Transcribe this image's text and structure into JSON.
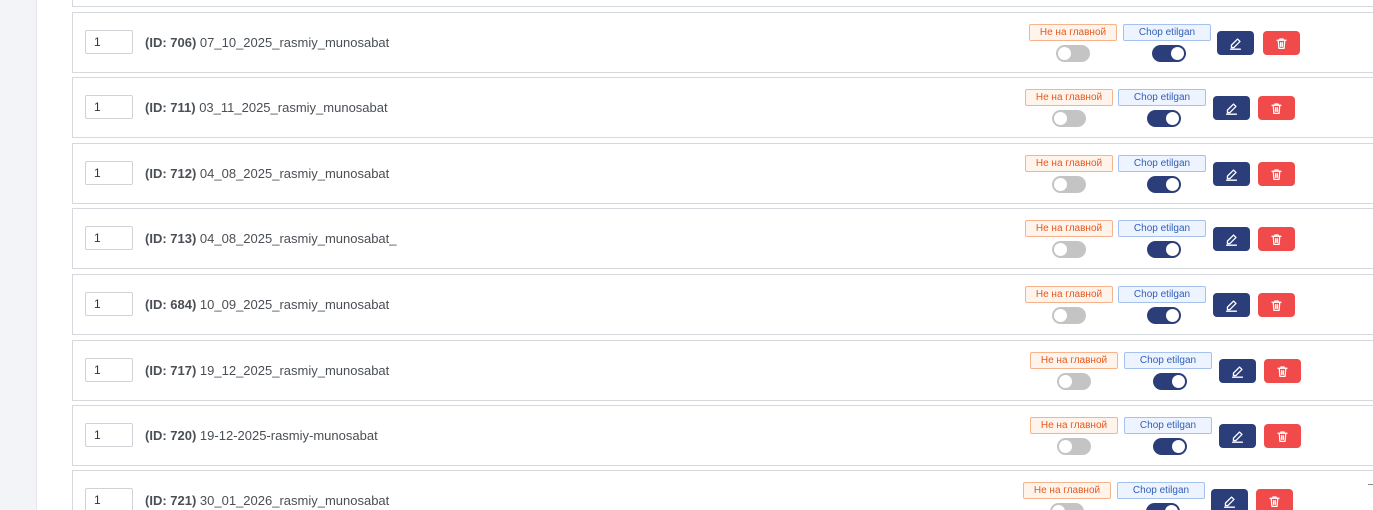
{
  "rows": [
    {
      "order": "1",
      "id_label": "(ID: 706)",
      "name": "07_10_2025_rasmiy_munosabat",
      "main_badge": "Не на главной",
      "printed_badge": "Chop etilgan",
      "main_on": false,
      "printed_on": true
    },
    {
      "order": "1",
      "id_label": "(ID: 711)",
      "name": "03_11_2025_rasmiy_munosabat",
      "main_badge": "Не на главной",
      "printed_badge": "Chop etilgan",
      "main_on": false,
      "printed_on": true
    },
    {
      "order": "1",
      "id_label": "(ID: 712)",
      "name": "04_08_2025_rasmiy_munosabat",
      "main_badge": "Не на главной",
      "printed_badge": "Chop etilgan",
      "main_on": false,
      "printed_on": true
    },
    {
      "order": "1",
      "id_label": "(ID: 713)",
      "name": "04_08_2025_rasmiy_munosabat_",
      "main_badge": "Не на главной",
      "printed_badge": "Chop etilgan",
      "main_on": false,
      "printed_on": true
    },
    {
      "order": "1",
      "id_label": "(ID: 684)",
      "name": "10_09_2025_rasmiy_munosabat",
      "main_badge": "Не на главной",
      "printed_badge": "Chop etilgan",
      "main_on": false,
      "printed_on": true
    },
    {
      "order": "1",
      "id_label": "(ID: 717)",
      "name": "19_12_2025_rasmiy_munosabat",
      "main_badge": "Не на главной",
      "printed_badge": "Chop etilgan",
      "main_on": false,
      "printed_on": true
    },
    {
      "order": "1",
      "id_label": "(ID: 720)",
      "name": "19-12-2025-rasmiy-munosabat",
      "main_badge": "Не на главной",
      "printed_badge": "Chop etilgan",
      "main_on": false,
      "printed_on": true
    },
    {
      "order": "1",
      "id_label": "(ID: 721)",
      "name": "30_01_2026_rasmiy_munosabat",
      "main_badge": "Не на главной",
      "printed_badge": "Chop etilgan",
      "main_on": false,
      "printed_on": true
    }
  ],
  "icons": {
    "edit": "pencil-icon",
    "delete": "trash-icon"
  },
  "colors": {
    "primary": "#2c3e7a",
    "danger": "#f04a4a",
    "main_badge_text": "#e5591f",
    "printed_badge_text": "#2f5fb8"
  }
}
